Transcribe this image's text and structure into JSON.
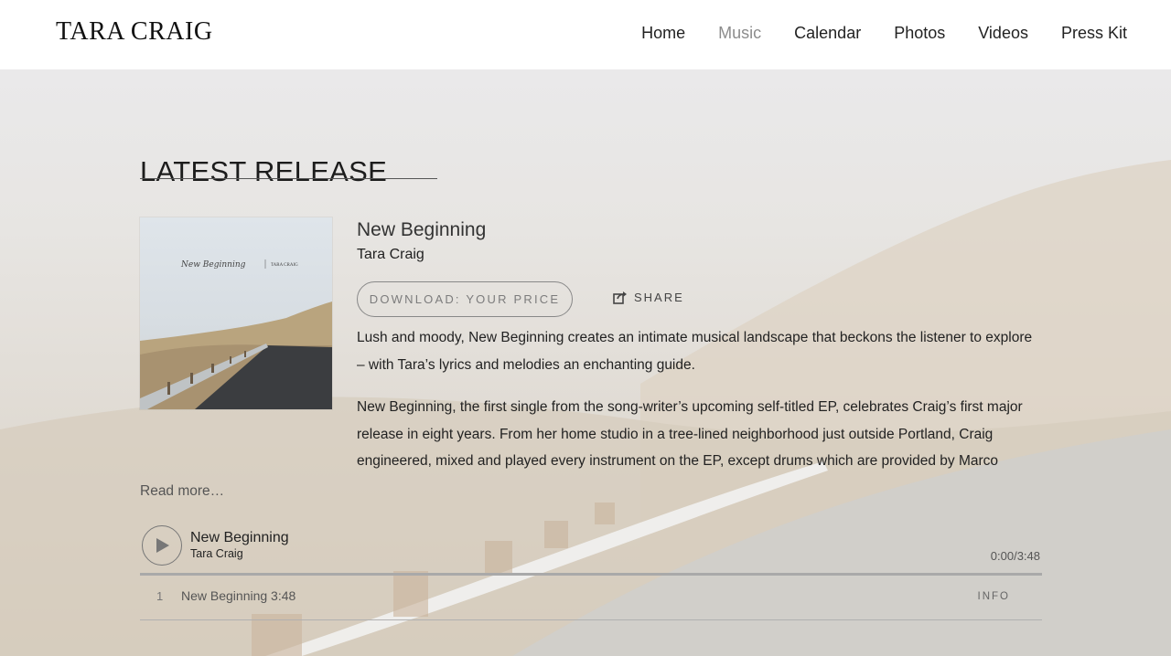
{
  "header": {
    "logo": "TARA CRAIG",
    "nav": [
      {
        "label": "Home",
        "active": false
      },
      {
        "label": "Music",
        "active": true
      },
      {
        "label": "Calendar",
        "active": false
      },
      {
        "label": "Photos",
        "active": false
      },
      {
        "label": "Videos",
        "active": false
      },
      {
        "label": "Press Kit",
        "active": false
      }
    ]
  },
  "release": {
    "section_title": "LATEST RELEASE",
    "cover_title": "New Beginning",
    "cover_artist": "TARA CRAIG",
    "title": "New Beginning",
    "artist": "Tara Craig",
    "download_label": "DOWNLOAD: YOUR PRICE",
    "share_label": "SHARE",
    "description": [
      "Lush and moody, New Beginning creates an intimate musical landscape that beckons the listener to explore – with Tara’s lyrics and melodies an enchanting guide.",
      "New Beginning, the first single from the song-writer’s upcoming self-titled EP, celebrates Craig’s first major release in eight years. From her home studio in a tree-lined neighborhood just outside Portland, Craig engineered, mixed and played every instrument on the EP, except drums which are provided by Marco"
    ],
    "read_more": "Read more…"
  },
  "player": {
    "track": "New Beginning",
    "artist": "Tara Craig",
    "time": "0:00/3:48",
    "progress": 0
  },
  "tracklist": [
    {
      "number": "1",
      "name": "New Beginning 3:48",
      "info_label": "INFO"
    }
  ],
  "colors": {
    "active_nav": "#8c8c8c",
    "text": "#222222",
    "button_border": "#888888"
  }
}
